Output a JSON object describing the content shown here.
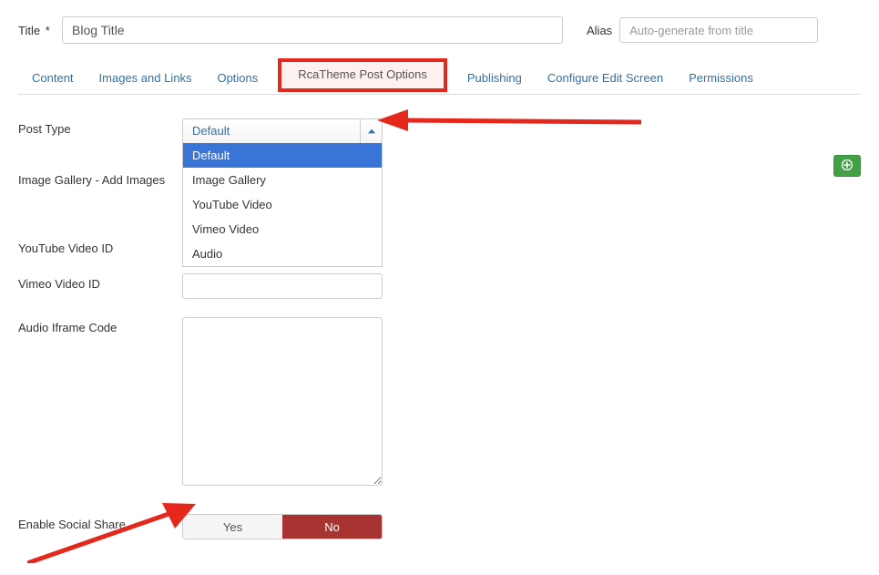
{
  "header": {
    "title_label": "Title",
    "title_required_mark": "*",
    "title_value": "Blog Title",
    "alias_label": "Alias",
    "alias_placeholder": "Auto-generate from title"
  },
  "tabs": {
    "content": "Content",
    "images_links": "Images and Links",
    "options": "Options",
    "rcatheme": "RcaTheme Post Options",
    "publishing": "Publishing",
    "configure": "Configure Edit Screen",
    "permissions": "Permissions"
  },
  "fields": {
    "post_type": "Post Type",
    "image_gallery": "Image Gallery - Add Images",
    "youtube_id": "YouTube Video ID",
    "vimeo_id": "Vimeo Video ID",
    "audio_iframe": "Audio Iframe Code",
    "enable_social": "Enable Social Share"
  },
  "post_type_select": {
    "selected": "Default",
    "options": {
      "opt0": "Default",
      "opt1": "Image Gallery",
      "opt2": "YouTube Video",
      "opt3": "Vimeo Video",
      "opt4": "Audio"
    }
  },
  "toggle": {
    "yes": "Yes",
    "no": "No"
  }
}
